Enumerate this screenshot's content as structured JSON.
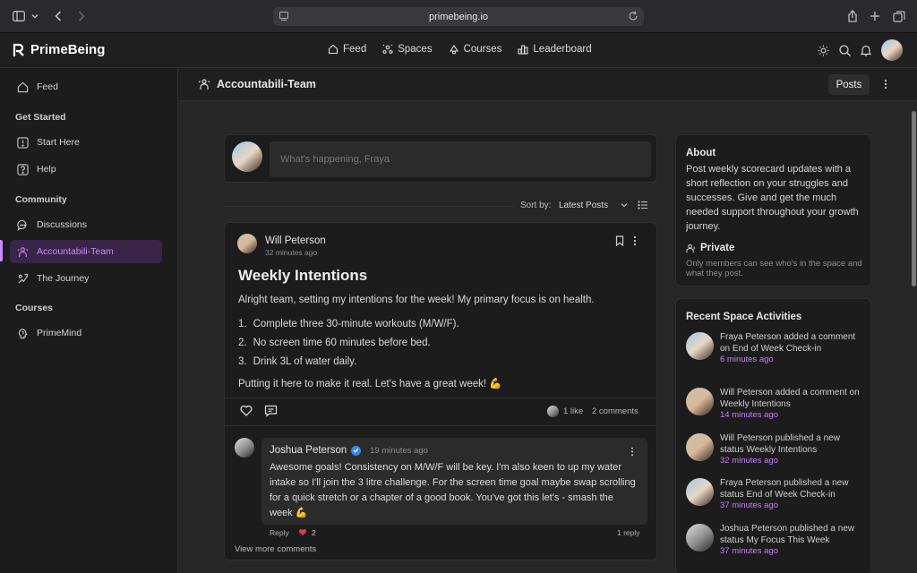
{
  "browser": {
    "url": "primebeing.io"
  },
  "brand": {
    "name": "PrimeBeing",
    "accent": "#c98bff"
  },
  "nav": {
    "links": [
      {
        "label": "Feed",
        "icon": "home-icon"
      },
      {
        "label": "Spaces",
        "icon": "spaces-icon"
      },
      {
        "label": "Courses",
        "icon": "courses-icon"
      },
      {
        "label": "Leaderboard",
        "icon": "leaderboard-icon"
      }
    ]
  },
  "sidebar": {
    "feed": "Feed",
    "get_started": {
      "heading": "Get Started",
      "items": [
        "Start Here",
        "Help"
      ]
    },
    "community": {
      "heading": "Community",
      "items": [
        "Discussions",
        "Accountabili-Team",
        "The Journey"
      ]
    },
    "courses": {
      "heading": "Courses",
      "items": [
        "PrimeMind"
      ]
    }
  },
  "space": {
    "title": "Accountabili-Team",
    "posts_button": "Posts"
  },
  "composer": {
    "placeholder": "What's happening, Fraya"
  },
  "sort": {
    "label": "Sort by:",
    "value": "Latest Posts"
  },
  "post": {
    "author": "Will Peterson",
    "time": "32 minutes ago",
    "title": "Weekly Intentions",
    "intro": "Alright team, setting my intentions for the week! My primary focus is on health.",
    "items": [
      {
        "n": "1.",
        "text": "Complete three 30-minute workouts (M/W/F)."
      },
      {
        "n": "2.",
        "text": "No screen time 60 minutes before bed."
      },
      {
        "n": "3.",
        "text": "Drink 3L of water daily."
      }
    ],
    "outro": "Putting it here to make it real. Let's have a great week! 💪",
    "likes": "1 like",
    "comments": "2 comments"
  },
  "comment": {
    "author": "Joshua Peterson",
    "time": "19 minutes ago",
    "text": "Awesome goals! Consistency on M/W/F will be key. I'm also keen to up my water intake so I'll join the 3 litre challenge. For the screen time goal maybe swap scrolling for a quick stretch or a chapter of a good book. You've got this let's - smash the week 💪",
    "reply": "Reply",
    "like_count": "2",
    "replies": "1 reply",
    "view_more": "View more comments"
  },
  "about": {
    "title": "About",
    "description": "Post weekly scorecard updates with a short reflection on your struggles and successes. Give and get the much needed support throughout your growth journey.",
    "privacy_title": "Private",
    "privacy_text": "Only members can see who's in the space and what they post."
  },
  "recent": {
    "title": "Recent Space Activities",
    "items": [
      {
        "text": "Fraya Peterson added a comment on End of Week Check-in",
        "ago": "6 minutes ago"
      },
      {
        "text": "Will Peterson added a comment on Weekly Intentions",
        "ago": "14 minutes ago"
      },
      {
        "text": "Will Peterson published a new status Weekly Intentions",
        "ago": "32 minutes ago"
      },
      {
        "text": "Fraya Peterson published a new status End of Week Check-in",
        "ago": "37 minutes ago"
      },
      {
        "text": "Joshua Peterson published a new status My Focus This Week",
        "ago": "37 minutes ago"
      }
    ]
  }
}
